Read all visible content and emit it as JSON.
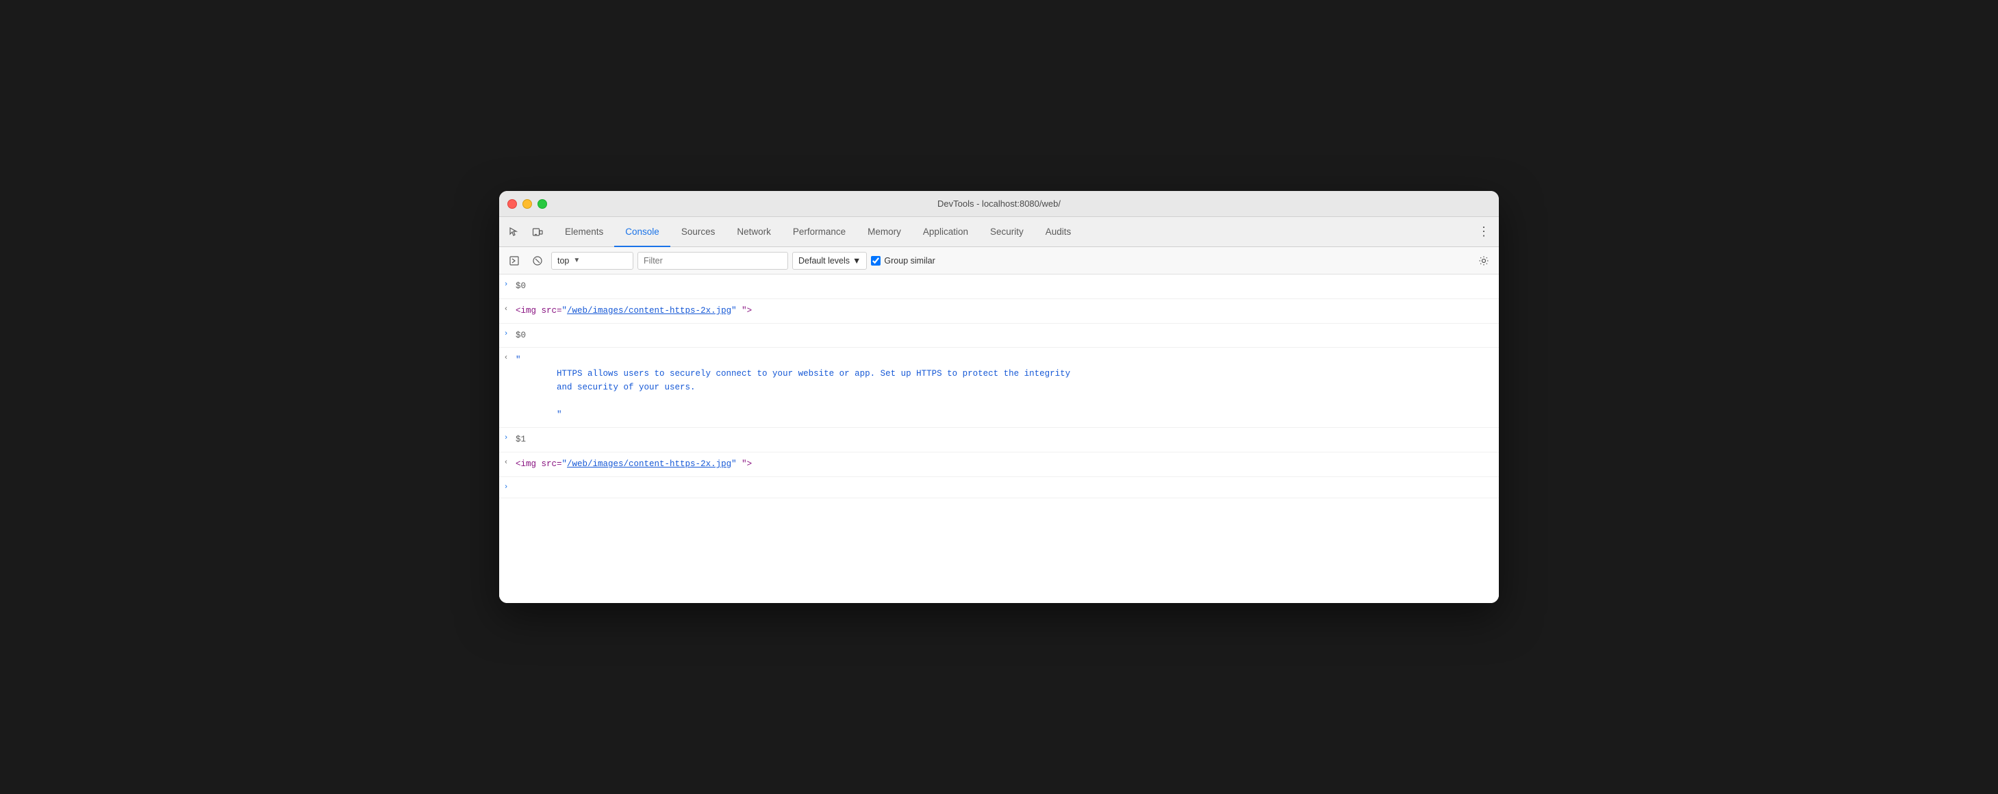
{
  "window": {
    "title": "DevTools - localhost:8080/web/"
  },
  "traffic_lights": {
    "red": "close",
    "yellow": "minimize",
    "green": "maximize"
  },
  "tabs": {
    "items": [
      {
        "id": "elements",
        "label": "Elements",
        "active": false
      },
      {
        "id": "console",
        "label": "Console",
        "active": true
      },
      {
        "id": "sources",
        "label": "Sources",
        "active": false
      },
      {
        "id": "network",
        "label": "Network",
        "active": false
      },
      {
        "id": "performance",
        "label": "Performance",
        "active": false
      },
      {
        "id": "memory",
        "label": "Memory",
        "active": false
      },
      {
        "id": "application",
        "label": "Application",
        "active": false
      },
      {
        "id": "security",
        "label": "Security",
        "active": false
      },
      {
        "id": "audits",
        "label": "Audits",
        "active": false
      }
    ]
  },
  "toolbar": {
    "context_label": "top",
    "filter_placeholder": "Filter",
    "levels_label": "Default levels",
    "group_similar_label": "Group similar",
    "group_similar_checked": true
  },
  "console_entries": [
    {
      "type": "result",
      "chevron": ">",
      "content": "$0"
    },
    {
      "type": "output",
      "chevron": "<",
      "html": true,
      "tag_open": "<img src=",
      "link": "/web/images/content-https-2x.jpg",
      "tag_close": "\" \">"
    },
    {
      "type": "result",
      "chevron": ">",
      "content": "$0"
    },
    {
      "type": "output_multiline",
      "chevron": "<",
      "lines": [
        "\"",
        "        HTTPS allows users to securely connect to your website or app. Set up HTTPS to protect the integrity",
        "        and security of your users.",
        "",
        "        \""
      ]
    },
    {
      "type": "result",
      "chevron": ">",
      "content": "$1"
    },
    {
      "type": "output",
      "chevron": "<",
      "html": true,
      "tag_open": "<img src=",
      "link": "/web/images/content-https-2x.jpg",
      "tag_close": "\" \">"
    }
  ],
  "input_prompt": ">"
}
